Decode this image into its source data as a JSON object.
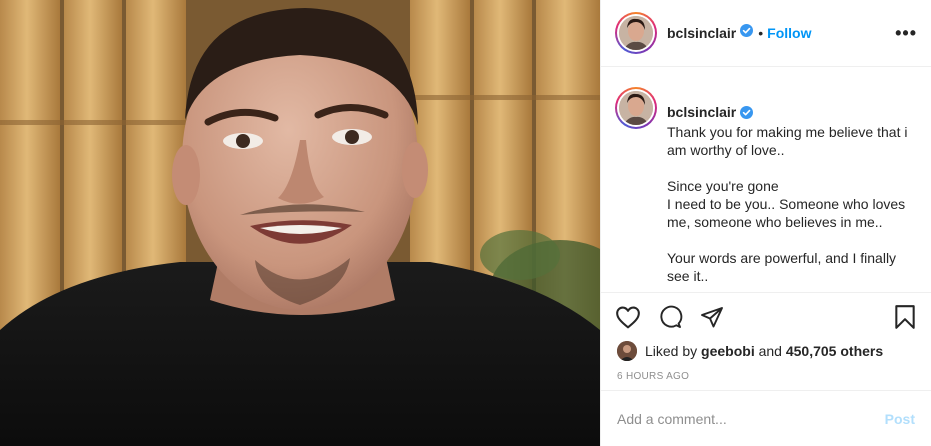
{
  "post": {
    "username": "bclsinclair",
    "follow_label": "Follow",
    "separator": "•",
    "more_label": "•••",
    "caption_paragraphs": [
      "Thank you for making me believe that i am worthy of love..",
      "Since you're gone\nI need to be you.. Someone who loves me, someone who believes in me..",
      "Your words are powerful, and I finally see it.."
    ],
    "likes": {
      "prefix": "Liked by ",
      "liker": "geebobi",
      "middle": " and ",
      "count": "450,705 others"
    },
    "timestamp": "6 HOURS AGO",
    "comment_placeholder": "Add a comment...",
    "post_button": "Post"
  },
  "icons": {
    "verified": "verified-badge-icon",
    "like": "heart-icon",
    "comment": "comment-bubble-icon",
    "share": "paper-plane-icon",
    "save": "bookmark-icon"
  },
  "colors": {
    "follow_blue": "#0095f6",
    "verified_blue": "#3897f0",
    "post_disabled": "#b2dffc",
    "muted": "#8e8e8e"
  }
}
